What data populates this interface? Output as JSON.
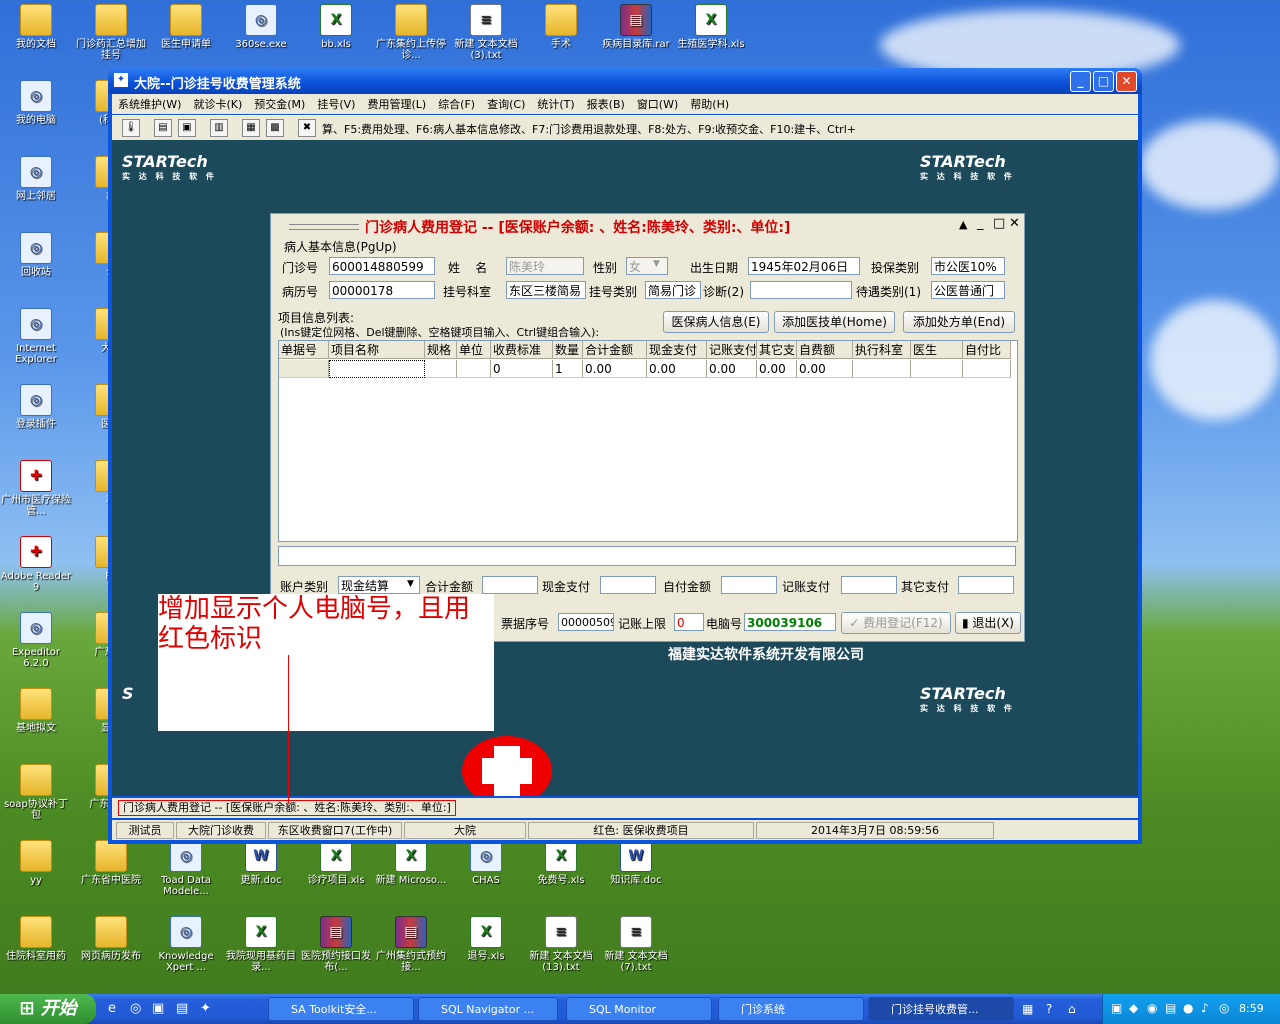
{
  "desktop_icons": [
    {
      "label": "我的文档",
      "type": "folder"
    },
    {
      "label": "门诊药汇总增加挂号",
      "type": "folder"
    },
    {
      "label": "医生申请单",
      "type": "folder"
    },
    {
      "label": "360se.exe",
      "type": "app"
    },
    {
      "label": "bb.xls",
      "type": "xls"
    },
    {
      "label": "广东集约上传停诊...",
      "type": "folder"
    },
    {
      "label": "新建 文本文档 (3).txt",
      "type": "txt"
    },
    {
      "label": "手术",
      "type": "folder"
    },
    {
      "label": "疾病目录库.rar",
      "type": "rar"
    },
    {
      "label": "生殖医学科.xls",
      "type": "xls"
    },
    {
      "label": "我的电脑",
      "type": "app"
    },
    {
      "label": "网上邻居",
      "type": "app"
    },
    {
      "label": "回收站",
      "type": "app"
    },
    {
      "label": "Internet Explorer",
      "type": "app"
    },
    {
      "label": "登录插件",
      "type": "app"
    },
    {
      "label": "广州市医疗保险管...",
      "type": "red"
    },
    {
      "label": "Adobe Reader 9",
      "type": "red"
    },
    {
      "label": "Expeditor 6.2.0",
      "type": "app"
    },
    {
      "label": "基地拟文",
      "type": "folder"
    },
    {
      "label": "soap协议补丁包",
      "type": "folder"
    },
    {
      "label": "yy",
      "type": "folder"
    },
    {
      "label": "住院科室用药",
      "type": "folder"
    },
    {
      "label": "广东省中医院",
      "type": "folder"
    },
    {
      "label": "网页病历发布",
      "type": "folder"
    },
    {
      "label": "Toad Data Modele...",
      "type": "app"
    },
    {
      "label": "Knowledge Xpert ...",
      "type": "app"
    },
    {
      "label": "更新.doc",
      "type": "doc"
    },
    {
      "label": "我院现用基药目录...",
      "type": "xls"
    },
    {
      "label": "诊疗项目.xls",
      "type": "xls"
    },
    {
      "label": "医院预约接口发布(...",
      "type": "rar"
    },
    {
      "label": "新建 Microso...",
      "type": "xls"
    },
    {
      "label": "广州集约式预约接...",
      "type": "rar"
    },
    {
      "label": "CHAS",
      "type": "app"
    },
    {
      "label": "退号.xls",
      "type": "xls"
    },
    {
      "label": "免费号.xls",
      "type": "xls"
    },
    {
      "label": "新建 文本文档 (13).txt",
      "type": "txt"
    },
    {
      "label": "知识库.doc",
      "type": "doc"
    },
    {
      "label": "新建 文本文档 (7).txt",
      "type": "txt"
    },
    {
      "label": "(科室",
      "type": "folder"
    },
    {
      "label": "病",
      "type": "folder"
    },
    {
      "label": "公",
      "type": "folder"
    },
    {
      "label": "大学",
      "type": "folder"
    },
    {
      "label": "医生",
      "type": "folder"
    },
    {
      "label": "项",
      "type": "folder"
    },
    {
      "label": "PL",
      "type": "folder"
    },
    {
      "label": "广东 挂",
      "type": "folder"
    },
    {
      "label": "显示",
      "type": "folder"
    },
    {
      "label": "广东 当天",
      "type": "folder"
    }
  ],
  "window": {
    "title": "大院--门诊挂号收费管理系统",
    "menu": [
      "系统维护(W)",
      "就诊卡(K)",
      "预交金(M)",
      "挂号(V)",
      "费用管理(L)",
      "综合(F)",
      "查询(C)",
      "统计(T)",
      "报表(B)",
      "窗口(W)",
      "帮助(H)"
    ],
    "toolbar_hint": "算、F5:费用处理、F6:病人基本信息修改、F7:门诊费用退款处理、F8:处方、F9:收预交金、F10:建卡、Ctrl+",
    "company": "福建实达软件系统开发有限公司",
    "logo_text": "STARTech",
    "logo_sub": "实 达 科 技 软 件",
    "status_caption": "门诊病人费用登记 -- [医保账户余额: 、姓名:陈美玲、类别:、单位:]",
    "status_cells": [
      "测试员",
      "大院门诊收费",
      "东区收费窗口7(工作中)",
      "大院",
      "红色: 医保收费项目",
      "2014年3月7日  08:59:56"
    ]
  },
  "dialog": {
    "title": "门诊病人费用登记 -- [医保账户余额: 、姓名:陈美玲、类别:、单位:]",
    "group_label": "病人基本信息(PgUp)",
    "fields": {
      "outpatient_no": {
        "label": "门诊号",
        "value": "600014880599"
      },
      "name": {
        "label": "姓    名",
        "value": "陈美玲"
      },
      "gender": {
        "label": "性别",
        "value": "女"
      },
      "birth": {
        "label": "出生日期",
        "value": "1945年02月06日"
      },
      "insure_type": {
        "label": "投保类别",
        "value": "市公医10%"
      },
      "record_no": {
        "label": "病历号",
        "value": "00000178"
      },
      "reg_dept": {
        "label": "挂号科室",
        "value": "东区三楼简易"
      },
      "reg_type": {
        "label": "挂号类别",
        "value": "简易门诊"
      },
      "diagnosis": {
        "label": "诊断(2)",
        "value": ""
      },
      "treat_type": {
        "label": "待遇类别(1)",
        "value": "公医普通门"
      }
    },
    "list_label": "项目信息列表:",
    "list_hint": "(Ins键定位网格、Del键删除、空格键项目输入、Ctrl键组合输入):",
    "buttons_top": [
      "医保病人信息(E)",
      "添加医技单(Home)",
      "添加处方单(End)"
    ],
    "columns": [
      "单据号",
      "项目名称",
      "规格",
      "单位",
      "收费标准",
      "数量",
      "合计金额",
      "现金支付",
      "记账支付",
      "其它支",
      "自费额",
      "执行科室",
      "医生",
      "自付比"
    ],
    "rows": [
      [
        "",
        "",
        "",
        "",
        "0",
        "1",
        "0.00",
        "0.00",
        "0.00",
        "0.00",
        "0.00",
        "",
        "",
        ""
      ]
    ],
    "account_type_label": "账户类别",
    "account_type_value": "现金结算",
    "totals_labels": [
      "合计金额",
      "现金支付",
      "自付金额",
      "记账支付",
      "其它支付"
    ],
    "receipt_label": "票据序号",
    "receipt_value": "00000509",
    "limit_label": "记账上限",
    "limit_value": "0",
    "pc_label": "电脑号",
    "pc_value": "300039106",
    "register_button": "费用登记(F12)",
    "exit_button": "退出(X)"
  },
  "annotation": "增加显示个人电脑号，且用红色标识",
  "taskbar": {
    "start": "开始",
    "tasks": [
      "SA Toolkit安全...",
      "SQL Navigator ...",
      "SQL Monitor",
      "门诊系统",
      "门诊挂号收费管..."
    ],
    "clock": "8:59"
  },
  "colors": {
    "title_red": "#d00000",
    "pc_green": "#008000",
    "client_bg": "#1c4a5a",
    "annotation_red": "#e00000"
  }
}
